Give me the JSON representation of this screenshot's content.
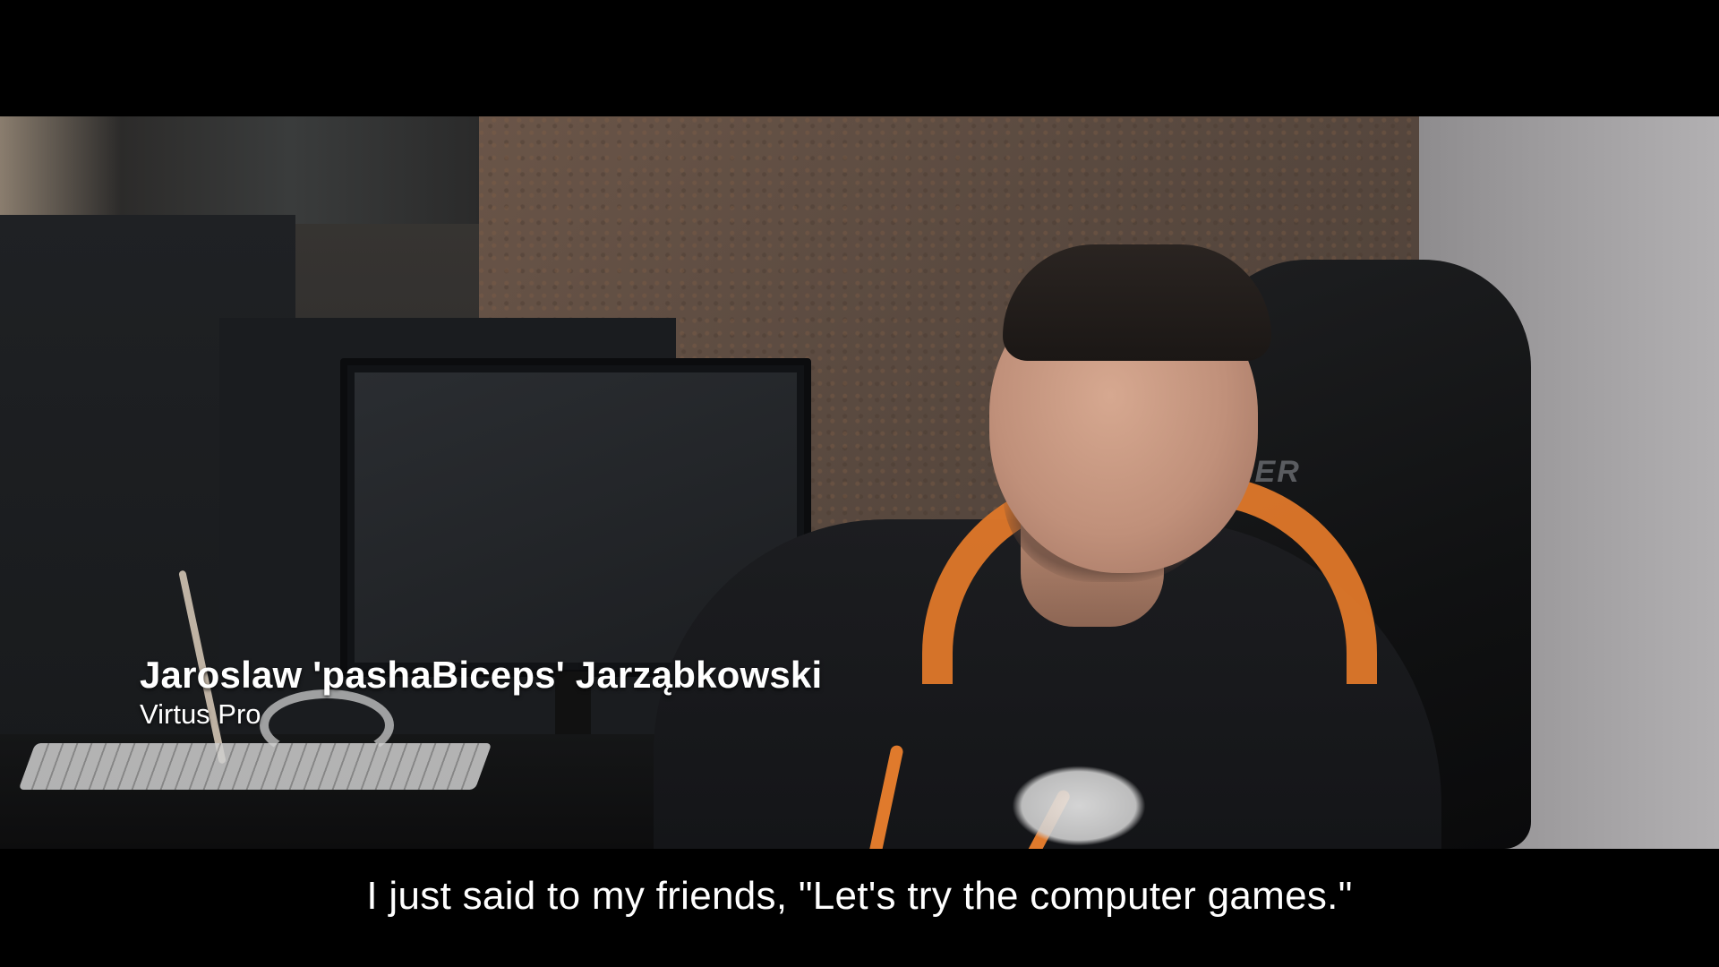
{
  "lower_third": {
    "name": "Jaroslaw 'pashaBiceps' Jarząbkowski",
    "team": "Virtus Pro"
  },
  "subtitle": {
    "text": "I just said to my friends, \"Let's try the computer games.\""
  },
  "scene": {
    "chair_logo": "CER"
  },
  "colors": {
    "letterbox": "#000000",
    "hoodie_accent": "#e0782a",
    "text": "#ffffff"
  }
}
